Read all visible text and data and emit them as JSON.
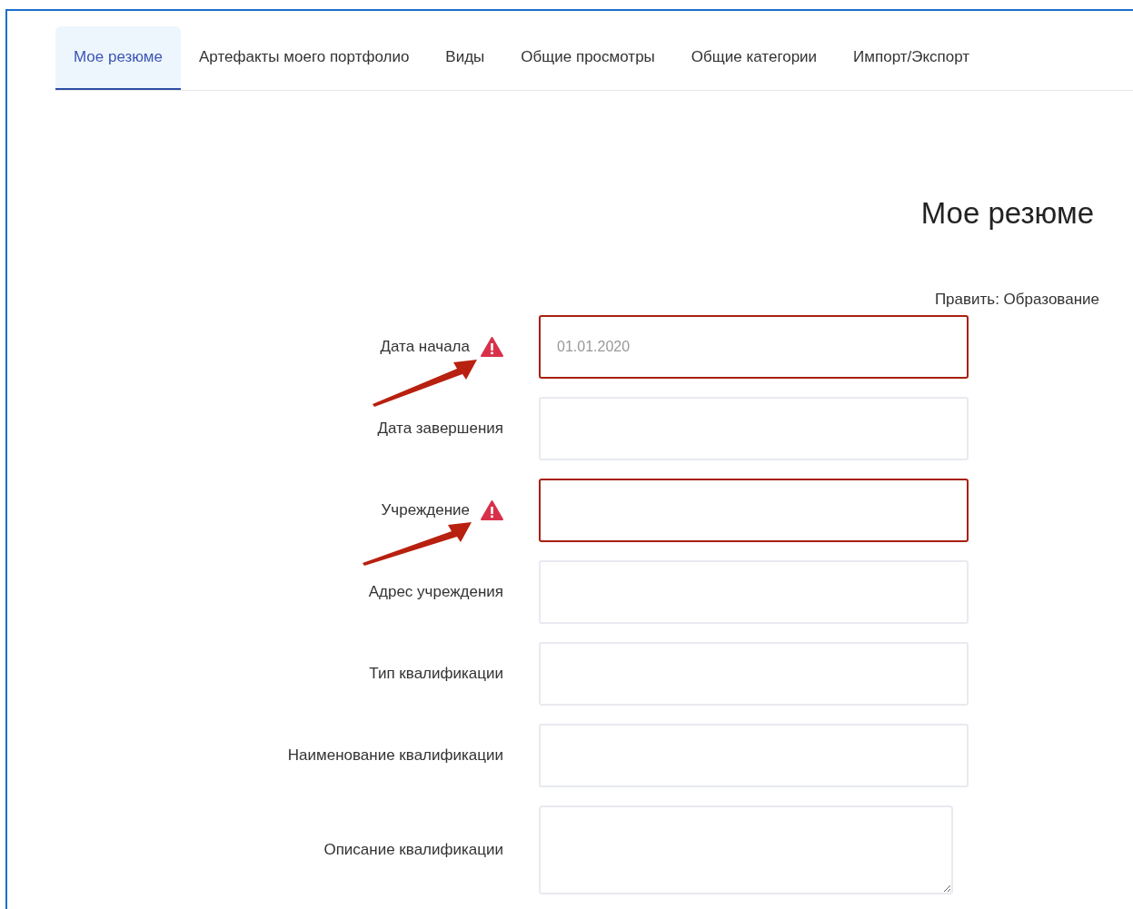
{
  "tabs": [
    {
      "label": "Мое резюме",
      "selected": true
    },
    {
      "label": "Артефакты моего портфолио",
      "selected": false
    },
    {
      "label": "Виды",
      "selected": false
    },
    {
      "label": "Общие просмотры",
      "selected": false
    },
    {
      "label": "Общие категории",
      "selected": false
    },
    {
      "label": "Импорт/Экспорт",
      "selected": false
    }
  ],
  "page_title": "Мое резюме",
  "section_title": "Править: Образование",
  "fields": [
    {
      "kind": "input",
      "label": "Дата начала",
      "placeholder": "01.01.2020",
      "error": true
    },
    {
      "kind": "input",
      "label": "Дата завершения",
      "error": false
    },
    {
      "kind": "input",
      "label": "Учреждение",
      "error": true
    },
    {
      "kind": "input",
      "label": "Адрес учреждения",
      "error": false
    },
    {
      "kind": "input",
      "label": "Тип квалификации",
      "error": false
    },
    {
      "kind": "input",
      "label": "Наименование квалификации",
      "error": false
    },
    {
      "kind": "textarea",
      "label": "Описание квалификации",
      "error": false
    }
  ]
}
